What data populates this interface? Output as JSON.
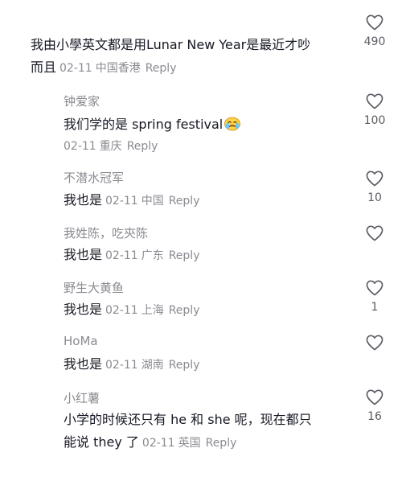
{
  "comments": [
    {
      "username": "",
      "line1": "我由小學英文都是用Lunar New Year是最近才吵",
      "line2": "而且",
      "date": "02-11",
      "location": "中国香港",
      "reply": "Reply",
      "likes": "490"
    },
    {
      "username": "钟爱家",
      "line1": "我们学的是 spring festival",
      "line2": "",
      "date": "02-11",
      "location": "重庆",
      "reply": "Reply",
      "likes": "100"
    },
    {
      "username": "不潜水冠军",
      "line1": "我也是",
      "line2": "",
      "date": "02-11",
      "location": "中国",
      "reply": "Reply",
      "likes": "10"
    },
    {
      "username": "我姓陈，吃㚒陈",
      "line1": "我也是",
      "line2": "",
      "date": "02-11",
      "location": "广东",
      "reply": "Reply",
      "likes": ""
    },
    {
      "username": "野生大黄鱼",
      "line1": "我也是",
      "line2": "",
      "date": "02-11",
      "location": "上海",
      "reply": "Reply",
      "likes": "1"
    },
    {
      "username": "HoMa",
      "line1": "我也是",
      "line2": "",
      "date": "02-11",
      "location": "湖南",
      "reply": "Reply",
      "likes": ""
    },
    {
      "username": "小红薯",
      "line1": "小学的时候还只有 he 和 she 呢，现在都只",
      "line2": "能说 they 了",
      "date": "02-11",
      "location": "英国",
      "reply": "Reply",
      "likes": "16"
    }
  ],
  "icons": {
    "like": "heart-outline-icon",
    "emoji": "crying-face-emoji-icon"
  },
  "colors": {
    "text": "#161823",
    "muted": "#8a8b91",
    "like_count": "#5b5c63"
  }
}
